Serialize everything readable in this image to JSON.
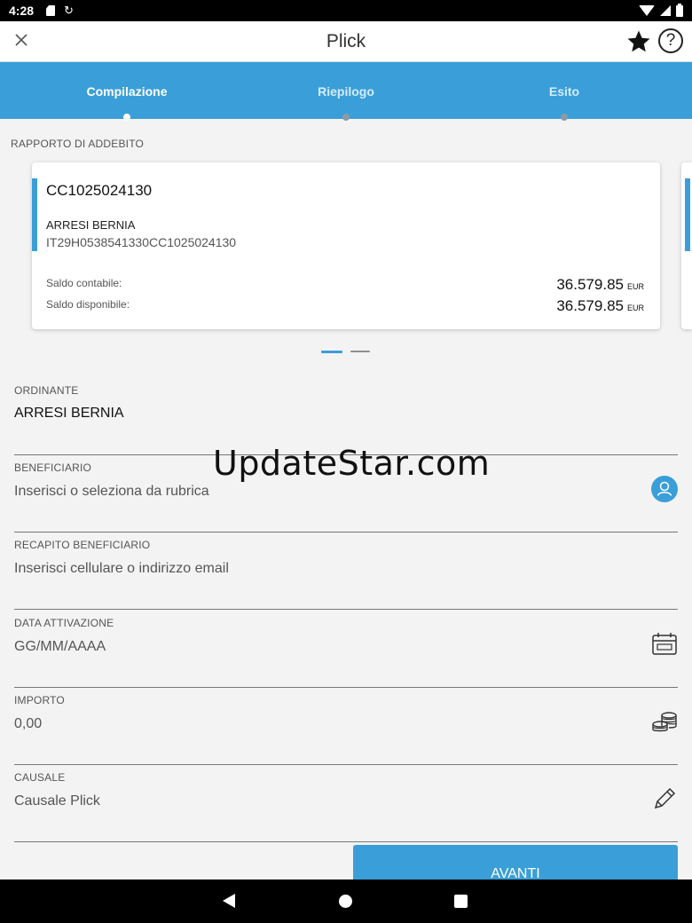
{
  "status_bar": {
    "time": "4:28"
  },
  "app_bar": {
    "title": "Plick",
    "close_icon": "close-icon",
    "star_icon": "star-icon",
    "help_icon": "help-icon",
    "help_glyph": "?"
  },
  "steps": [
    {
      "label": "Compilazione",
      "active": true
    },
    {
      "label": "Riepilogo",
      "active": false
    },
    {
      "label": "Esito",
      "active": false
    }
  ],
  "debit_section_label": "RAPPORTO DI ADDEBITO",
  "account": {
    "number": "CC1025024130",
    "holder": "ARRESI BERNIA",
    "iban": "IT29H0538541330CC1025024130",
    "balance_label": "Saldo contabile:",
    "balance_value": "36.579.85",
    "available_label": "Saldo disponibile:",
    "available_value": "36.579.85",
    "currency": "EUR"
  },
  "form": {
    "ordinante": {
      "label": "ORDINANTE",
      "value": "ARRESI BERNIA"
    },
    "beneficiario": {
      "label": "BENEFICIARIO",
      "placeholder": "Inserisci o seleziona da rubrica",
      "icon": "contact-icon"
    },
    "recapito": {
      "label": "RECAPITO BENEFICIARIO",
      "placeholder": "Inserisci cellulare o indirizzo email"
    },
    "data": {
      "label": "DATA ATTIVAZIONE",
      "placeholder": "GG/MM/AAAA",
      "icon": "calendar-icon"
    },
    "importo": {
      "label": "IMPORTO",
      "placeholder": "0,00",
      "icon": "coins-icon"
    },
    "causale": {
      "label": "CAUSALE",
      "placeholder": "Causale Plick",
      "icon": "pencil-icon"
    }
  },
  "watermark": "UpdateStar.com",
  "avanti_label": "AVANTI",
  "colors": {
    "accent": "#3a9fd8",
    "background": "#f3f3f3"
  }
}
